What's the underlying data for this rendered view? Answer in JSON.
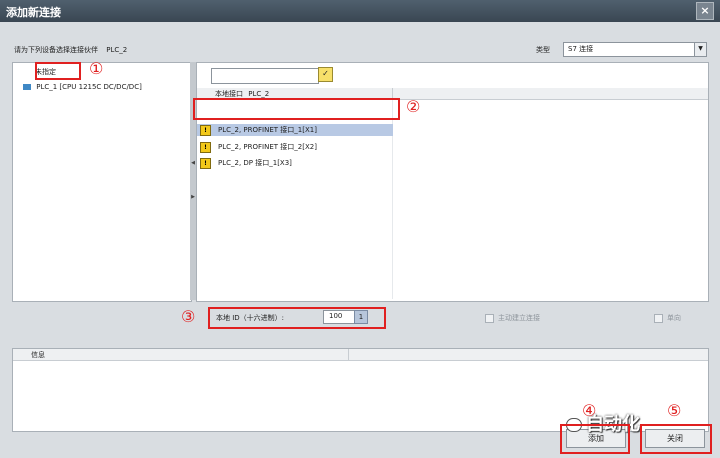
{
  "window": {
    "title": "添加新连接",
    "close_label": "×"
  },
  "prompt": {
    "text": "请为下列设备选择连接伙伴",
    "device": "PLC_2"
  },
  "type_selector": {
    "label": "类型",
    "value": "S7 连接",
    "arrow": "▼"
  },
  "tree": {
    "header": "未指定",
    "items": [
      {
        "label": "PLC_1 [CPU 1215C DC/DC/DC]",
        "icon": "plc-device-icon"
      }
    ]
  },
  "splitter": {
    "arrow_left": "◀",
    "arrow_right": "▶"
  },
  "interfaces": {
    "search_placeholder": "",
    "filter_icon": "✓",
    "column_header": "本地接口",
    "column_device": "PLC_2",
    "warn_glyph": "!",
    "rows": [
      {
        "label": "PLC_2, PROFINET 接口_1[X1]",
        "selected": true
      },
      {
        "label": "PLC_2, PROFINET 接口_2[X2]",
        "selected": false
      },
      {
        "label": "PLC_2, DP 接口_1[X3]",
        "selected": false
      }
    ]
  },
  "local_id": {
    "label": "本地 ID（十六进制）:",
    "value": "100",
    "button": "1"
  },
  "options": {
    "auto_setup": "主动建立连接",
    "unilateral": "单向"
  },
  "info": {
    "header": "信息"
  },
  "buttons": {
    "add": "添加",
    "close": "关闭"
  },
  "callouts": [
    "①",
    "②",
    "③",
    "④",
    "⑤"
  ],
  "watermark": "自动化",
  "colors": {
    "accent": "#e02020",
    "selection": "#b8c9e4",
    "titlebar": "#3a4652"
  }
}
